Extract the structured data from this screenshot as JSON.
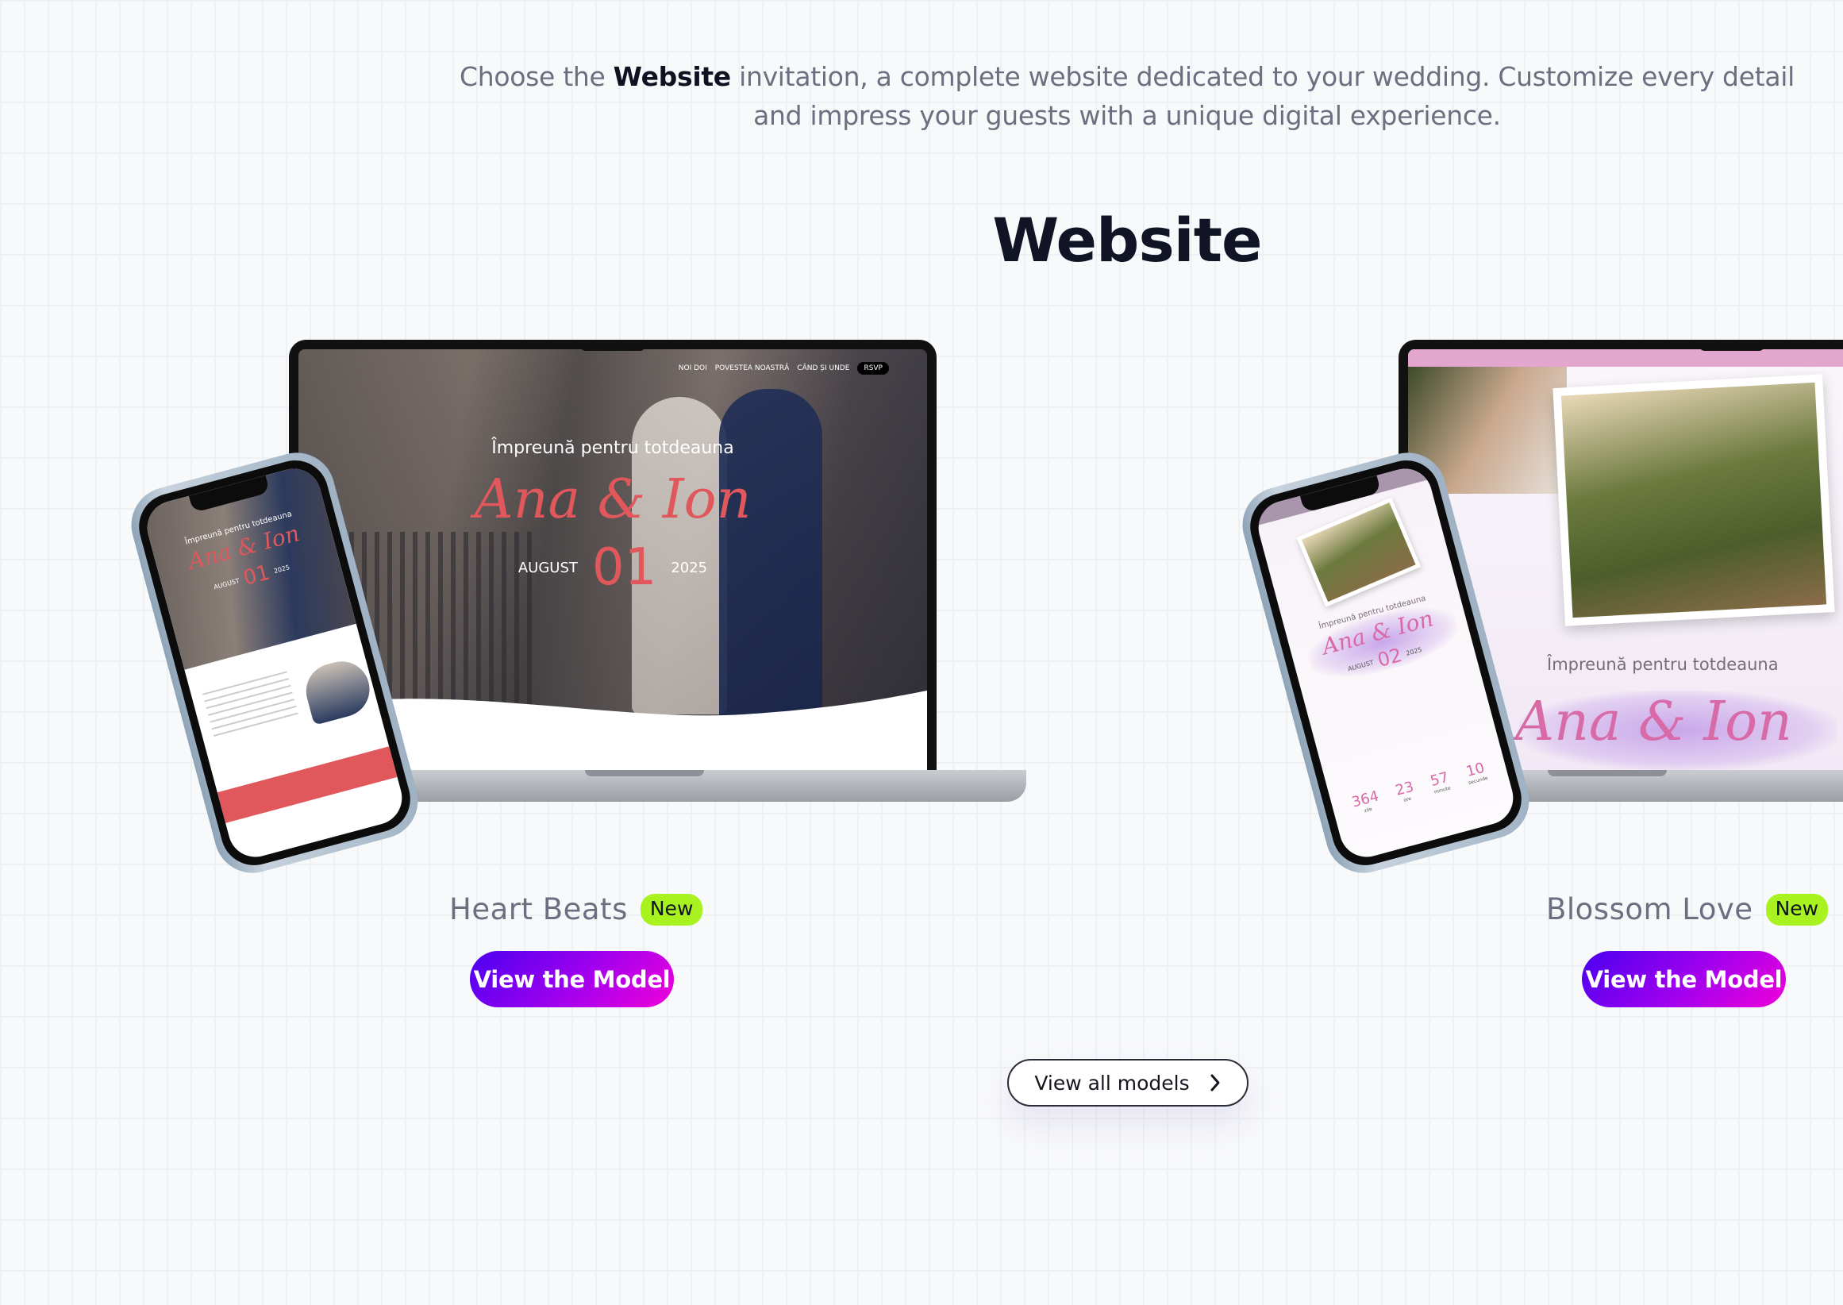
{
  "intro": {
    "before": "Choose the ",
    "bold": "Website",
    "after": " invitation, a complete website dedicated to your wedding. Customize every detail and impress your guests with a unique digital experience."
  },
  "section_title": "Website",
  "models": [
    {
      "name": "Heart Beats",
      "badge": "New",
      "button": "View the Model",
      "preview": {
        "nav": [
          "NOI DOI",
          "POVESTEA NOASTRĂ",
          "CÂND ȘI UNDE"
        ],
        "rsvp": "RSVP",
        "tagline": "Împreună pentru totdeauna",
        "couple": "Ana & Ion",
        "month": "AUGUST",
        "day": "01",
        "year": "2025",
        "accent": "#e0575c"
      }
    },
    {
      "name": "Blossom Love",
      "badge": "New",
      "button": "View the Model",
      "preview": {
        "tagline": "Împreună pentru totdeauna",
        "couple": "Ana & Ion",
        "month": "AUGUST",
        "day": "02",
        "year": "2025",
        "countdown": [
          {
            "value": "364",
            "unit": "zile"
          },
          {
            "value": "23",
            "unit": "ore"
          },
          {
            "value": "57",
            "unit": "minute"
          },
          {
            "value": "10",
            "unit": "secunde"
          }
        ],
        "accent": "#d86aa8"
      }
    }
  ],
  "view_all": {
    "label": "View all models",
    "icon": "chevron-right-icon"
  },
  "colors": {
    "badge": "#a7f21f",
    "button_gradient": [
      "#4a00f0",
      "#f000d8"
    ],
    "heading": "#101424"
  }
}
